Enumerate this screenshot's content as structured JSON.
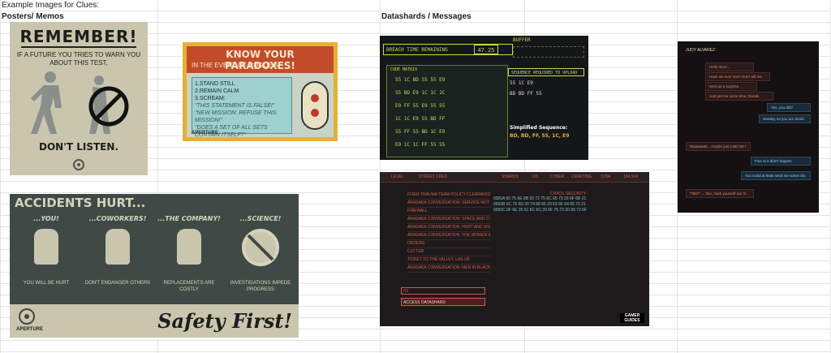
{
  "sheet": {
    "title": "Example Images for Clues:",
    "section_left": "Posters/ Memos",
    "section_right": "Datashards / Messages"
  },
  "poster_remember": {
    "heading": "REMEMBER!",
    "body": "IF A FUTURE YOU TRIES TO WARN YOU ABOUT THIS TEST,",
    "footer": "DON'T LISTEN."
  },
  "poster_paradox": {
    "heading": "KNOW YOUR PARADOXES!",
    "subheading": "IN THE EVENT OF ROGUE AI",
    "steps": [
      "1.STAND STILL",
      "2.REMAIN CALM",
      "3.SCREAM:"
    ],
    "quotes": [
      "\"THIS STATEMENT IS FALSE!\"",
      "\"NEW MISSION: REFUSE THIS MISSION!\"",
      "\"DOES A SET OF ALL SETS CONTAIN ITSELF?\""
    ],
    "brand": "APERTURE"
  },
  "poster_accidents": {
    "heading": "ACCIDENTS HURT...",
    "columns": [
      {
        "label": "...YOU!",
        "caption": "YOU WILL BE HURT"
      },
      {
        "label": "...COWORKERS!",
        "caption": "DON'T ENDANGER OTHERS"
      },
      {
        "label": "...THE COMPANY!",
        "caption": "REPLACEMENTS ARE COSTLY"
      },
      {
        "label": "...SCIENCE!",
        "caption": "INVESTIGATIONS IMPEDE PROGRESS"
      }
    ],
    "brand": "APERTURE",
    "slogan": "Safety First!"
  },
  "datashard_breach": {
    "breach_label": "BREACH TIME REMAINING",
    "timer": "47.25",
    "buffer_label": "BUFFER",
    "matrix_title": "CODE MATRIX",
    "matrix": [
      "55  1C  BD  55  55  E9",
      "55  BD  E9  1C  1C  1C",
      "E9  FF  55  E9  55  55",
      "1C  1C  E9  55  BD  FF",
      "55  FF  55  BD  1C  E9",
      "E9  1C  1C  FF  55  55"
    ],
    "sequence_label": "SEQUENCE REQUIRED TO UPLOAD",
    "sequences": [
      "55  1C  E9",
      "BD  BD  FF  55"
    ],
    "simplified_label": "Simplified Sequence:",
    "simplified_value": "BD, BD, FF, 55, 1C, E9"
  },
  "datashard_shards": {
    "top_labels": [
      "LEVEL",
      "STREET CRED",
      "SHARDS",
      "OS",
      "CYBER",
      "CRAFTING",
      "3,094",
      "104,504"
    ],
    "items": [
      "FIXER TRAUMA TEAM POLICY CLEARANCE",
      "ARASAKA CONVERSATION: SERVICE NOT NEEDED",
      "FIREWALL",
      "ARASAKA CONVERSATION: SPACE AND CYCLE",
      "ARASAKA CONVERSATION: HURT AND SHADOWS",
      "ARASAKA CONVERSATION: THE WOMEN IN PATTERN AND YOU",
      "ORDERS",
      "CUTTER",
      "TICKET TO THE VALLEY, LAS VE",
      "ARASAKA CONVERSATION: MEN IN BLACK"
    ],
    "detail_title": "CRACK SECURITY",
    "detail_rows": [
      "0000A  50 75 6E 6B 20 72 75 6C 65 73 20 6F 6B 21",
      "0000B  6C 75 6D 20 74 68 65 20 63 6F 64 65 73 21",
      "0000C  6F 6E 20 61 6C 6C 20 6F 75 72 20 66 72 6F"
    ],
    "select_value": "D1",
    "button_label": "ACCESS DATASHARD",
    "logo": "GAMER GUIDES"
  },
  "datashard_chat": {
    "contact": "JUDY ALVAREZ",
    "messages": [
      {
        "side": "in",
        "text": "Hello there..."
      },
      {
        "side": "in",
        "text": "Have we ever met? Don't tell me."
      },
      {
        "side": "in",
        "text": "Sent as a surprise..."
      },
      {
        "side": "in",
        "text": "Just put me some time, friends."
      },
      {
        "side": "out",
        "text": "Yes, you did?"
      },
      {
        "side": "out",
        "text": "Sneaky, so you are dumb"
      },
      {
        "side": "in",
        "text": "Waaaaaait... maybe just a BD OK?"
      },
      {
        "side": "out",
        "text": "Fine or it didn't happen"
      },
      {
        "side": "out",
        "text": "You could at least send me some info"
      },
      {
        "side": "in",
        "text": "**BD** ... fine, mark yourself out :D"
      }
    ]
  }
}
